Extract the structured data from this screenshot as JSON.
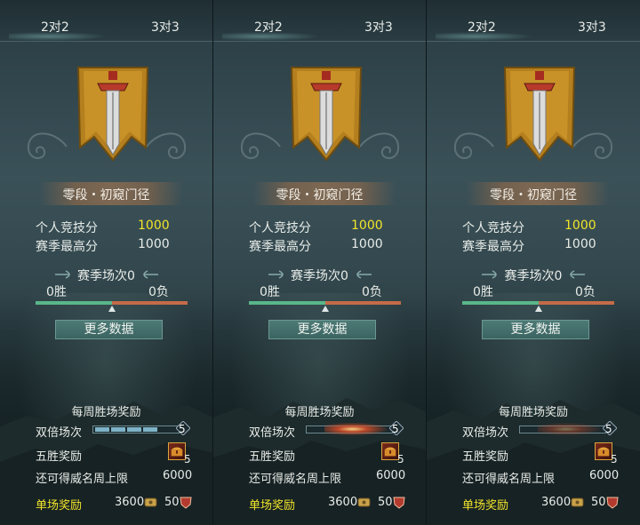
{
  "colors": {
    "gold": "#f2e52a",
    "win_bar": "#59b78a",
    "loss_bar": "#c46b48",
    "button": "#3b6461"
  },
  "panels": [
    {
      "tabs": [
        "2对2",
        "3对3"
      ],
      "rank_title": "零段・初窥门径",
      "stats": [
        {
          "label": "个人竞技分",
          "value": "1000"
        },
        {
          "label": "赛季最高分",
          "value": "1000"
        }
      ],
      "season_title": "赛季场次0",
      "wins": "0胜",
      "losses": "0负",
      "win_ratio": 0.5,
      "more_button": "更多数据",
      "weekly_title": "每周胜场奖励",
      "double_label": "双倍场次",
      "double_value": "5",
      "double_progress": 0.8,
      "five_win_label": "五胜奖励",
      "five_win_count": "5",
      "cap_label": "还可得威名周上限",
      "cap_value": "6000",
      "single_label": "单场奖励",
      "single_coins": "3600",
      "single_badge": "50",
      "icons": [
        "sword-banner-icon",
        "treasure-chest-icon",
        "coin-icon",
        "shield-icon"
      ]
    },
    {
      "tabs": [
        "2对2",
        "3对3"
      ],
      "rank_title": "零段・初窥门径",
      "stats": [
        {
          "label": "个人竞技分",
          "value": "1000"
        },
        {
          "label": "赛季最高分",
          "value": "1000"
        }
      ],
      "season_title": "赛季场次0",
      "wins": "0胜",
      "losses": "0负",
      "win_ratio": 0.5,
      "more_button": "更多数据",
      "weekly_title": "每周胜场奖励",
      "double_label": "双倍场次",
      "double_value": "5",
      "double_progress": 0.0,
      "five_win_label": "五胜奖励",
      "five_win_count": "5",
      "cap_label": "还可得威名周上限",
      "cap_value": "6000",
      "single_label": "单场奖励",
      "single_coins": "3600",
      "single_badge": "50",
      "icons": [
        "sword-banner-icon",
        "treasure-chest-icon",
        "coin-icon",
        "shield-icon"
      ]
    },
    {
      "tabs": [
        "2对2",
        "3对3"
      ],
      "rank_title": "零段・初窥门径",
      "stats": [
        {
          "label": "个人竞技分",
          "value": "1000"
        },
        {
          "label": "赛季最高分",
          "value": "1000"
        }
      ],
      "season_title": "赛季场次0",
      "wins": "0胜",
      "losses": "0负",
      "win_ratio": 0.5,
      "more_button": "更多数据",
      "weekly_title": "每周胜场奖励",
      "double_label": "双倍场次",
      "double_value": "5",
      "double_progress": 0.0,
      "five_win_label": "五胜奖励",
      "five_win_count": "5",
      "cap_label": "还可得威名周上限",
      "cap_value": "6000",
      "single_label": "单场奖励",
      "single_coins": "3600",
      "single_badge": "50",
      "icons": [
        "sword-banner-icon",
        "treasure-chest-icon",
        "coin-icon",
        "shield-icon"
      ]
    }
  ]
}
